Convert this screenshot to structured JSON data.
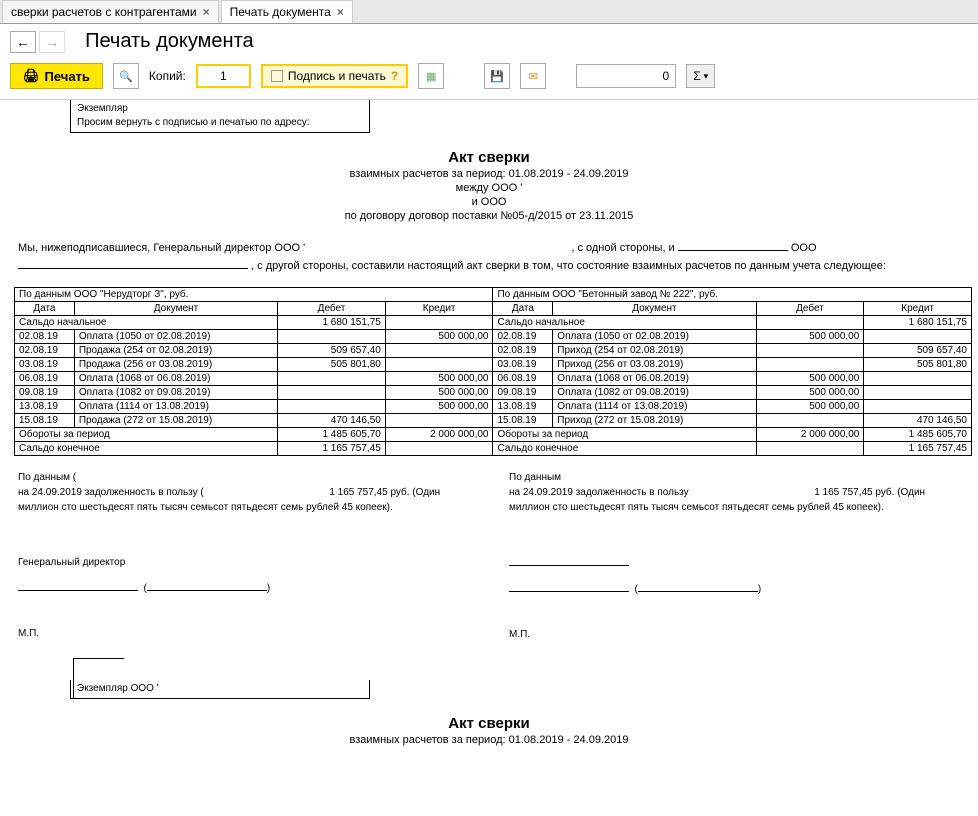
{
  "tabs": [
    {
      "label": "сверки расчетов с контрагентами"
    },
    {
      "label": "Печать документа"
    }
  ],
  "page_title": "Печать документа",
  "toolbar": {
    "print_label": "Печать",
    "copies_label": "Копий:",
    "copies_value": "1",
    "sign_label": "Подпись и печать",
    "num_value": "0",
    "sum_label": "Σ"
  },
  "top_box": {
    "line1": "Экземпляр",
    "line2": "Просим вернуть с подписью и печатью по адресу:"
  },
  "doc": {
    "title": "Акт сверки",
    "sub1": "взаимных расчетов за период: 01.08.2019 - 24.09.2019",
    "sub2": "между ООО '",
    "sub3": "и ООО",
    "sub4": "по договору договор поставки №05-д/2015 от 23.11.2015",
    "text_part1": "Мы, нижеподписавшиеся, Генеральный директор ООО '",
    "text_part2": ", с одной стороны, и ",
    "text_part3_tail": " ООО",
    "text_part4": ", с другой стороны, составили настоящий акт сверки в том, что состояние взаимных расчетов по данным учета следующее:"
  },
  "table": {
    "left_header": "По данным ООО \"Нерудторг З\", руб.",
    "right_header": "По данным ООО \"Бетонный завод № 222\", руб.",
    "col_date": "Дата",
    "col_doc": "Документ",
    "col_debit": "Дебет",
    "col_credit": "Кредит",
    "saldo_start": "Сальдо начальное",
    "saldo_start_left_debit": "1 680 151,75",
    "saldo_start_right_credit": "1 680 151,75",
    "rows": [
      {
        "d": "02.08.19",
        "ldoc": "Оплата (1050 от 02.08.2019)",
        "ld": "",
        "lc": "500 000,00",
        "rdoc": "Оплата (1050 от 02.08.2019)",
        "rd": "500 000,00",
        "rc": ""
      },
      {
        "d": "02.08.19",
        "ldoc": "Продажа (254 от 02.08.2019)",
        "ld": "509 657,40",
        "lc": "",
        "rdoc": "Приход (254 от 02.08.2019)",
        "rd": "",
        "rc": "509 657,40"
      },
      {
        "d": "03.08.19",
        "ldoc": "Продажа (256 от 03.08.2019)",
        "ld": "505 801,80",
        "lc": "",
        "rdoc": "Приход (256 от 03.08.2019)",
        "rd": "",
        "rc": "505 801,80"
      },
      {
        "d": "06.08.19",
        "ldoc": "Оплата (1068 от 06.08.2019)",
        "ld": "",
        "lc": "500 000,00",
        "rdoc": "Оплата (1068 от 06.08.2019)",
        "rd": "500 000,00",
        "rc": ""
      },
      {
        "d": "09.08.19",
        "ldoc": "Оплата (1082 от 09.08.2019)",
        "ld": "",
        "lc": "500 000,00",
        "rdoc": "Оплата (1082 от 09.08.2019)",
        "rd": "500 000,00",
        "rc": ""
      },
      {
        "d": "13.08.19",
        "ldoc": "Оплата (1114 от 13.08.2019)",
        "ld": "",
        "lc": "500 000,00",
        "rdoc": "Оплата (1114 от 13.08.2019)",
        "rd": "500 000,00",
        "rc": ""
      },
      {
        "d": "15.08.19",
        "ldoc": "Продажа (272 от 15.08.2019)",
        "ld": "470 146,50",
        "lc": "",
        "rdoc": "Приход (272 от 15.08.2019)",
        "rd": "",
        "rc": "470 146,50"
      }
    ],
    "turnover_label": "Обороты за период",
    "turnover_left_d": "1 485 605,70",
    "turnover_left_c": "2 000 000,00",
    "turnover_right_d": "2 000 000,00",
    "turnover_right_c": "1 485 605,70",
    "saldo_end_label": "Сальдо конечное",
    "saldo_end_left_d": "1 165 757,45",
    "saldo_end_right_c": "1 165 757,45"
  },
  "footer": {
    "left_line1": "По данным (",
    "left_line2": "на 24.09.2019 задолженность в пользу (",
    "left_amount": "1 165 757,45 руб. (Один",
    "left_words": "миллион сто шестьдесят пять тысяч семьсот пятьдесят семь рублей 45 копеек).",
    "right_line1": "По данным",
    "right_line2": "на 24.09.2019 задолженность в пользу",
    "right_amount": "1 165 757,45 руб. (Один",
    "right_words": "миллион сто шестьдесят пять тысяч семьсот пятьдесят семь рублей 45 копеек).",
    "gendir": "Генеральный директор",
    "mp": "М.П."
  },
  "second": {
    "label": "Экземпляр ООО '"
  }
}
